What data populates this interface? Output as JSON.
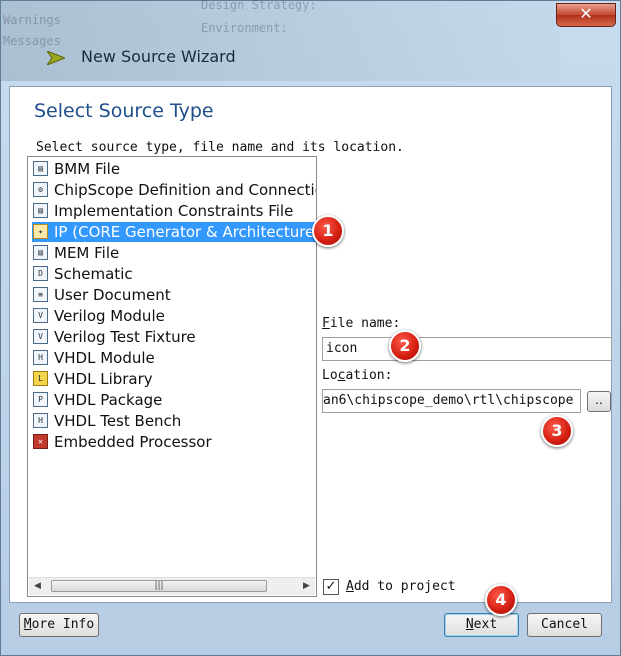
{
  "window": {
    "title": "New Source Wizard",
    "close_label": "✕",
    "background_lines": [
      "Design Strategy:",
      "Environment:",
      "Warnings",
      "Messages"
    ]
  },
  "page": {
    "heading": "Select Source Type",
    "subtitle": "Select source type, file name and its location."
  },
  "source_types": {
    "selected_index": 3,
    "items": [
      {
        "label": "BMM File",
        "icon": "bmm-file-icon",
        "glyph": "▤"
      },
      {
        "label": "ChipScope Definition and Connectio",
        "icon": "chipscope-icon",
        "glyph": "⚙"
      },
      {
        "label": "Implementation Constraints File",
        "icon": "constraints-file-icon",
        "glyph": "▤"
      },
      {
        "label": "IP (CORE Generator & Architecture",
        "icon": "ip-core-icon",
        "glyph": "✦"
      },
      {
        "label": "MEM File",
        "icon": "mem-file-icon",
        "glyph": "▤"
      },
      {
        "label": "Schematic",
        "icon": "schematic-icon",
        "glyph": "D"
      },
      {
        "label": "User Document",
        "icon": "user-document-icon",
        "glyph": "≡"
      },
      {
        "label": "Verilog Module",
        "icon": "verilog-module-icon",
        "glyph": "V"
      },
      {
        "label": "Verilog Test Fixture",
        "icon": "verilog-test-fixture-icon",
        "glyph": "V"
      },
      {
        "label": "VHDL Module",
        "icon": "vhdl-module-icon",
        "glyph": "H"
      },
      {
        "label": "VHDL Library",
        "icon": "vhdl-library-icon",
        "glyph": "L"
      },
      {
        "label": "VHDL Package",
        "icon": "vhdl-package-icon",
        "glyph": "P"
      },
      {
        "label": "VHDL Test Bench",
        "icon": "vhdl-test-bench-icon",
        "glyph": "H"
      },
      {
        "label": "Embedded Processor",
        "icon": "embedded-processor-icon",
        "glyph": "✕"
      }
    ],
    "scroll_left": "◀",
    "scroll_right": "▶",
    "scroll_thumb": "|||"
  },
  "file_name": {
    "label_mnemonic": "F",
    "label_rest": "ile name:",
    "value": "icon"
  },
  "location": {
    "label_start": "Lo",
    "label_mnemonic": "c",
    "label_rest": "ation:",
    "value": "an6\\chipscope_demo\\rtl\\chipscope",
    "browse_label": ".."
  },
  "add_to_project": {
    "checked": true,
    "check_glyph": "✓",
    "label_mnemonic": "A",
    "label_rest": "dd to project"
  },
  "buttons": {
    "more_info_mnemonic": "M",
    "more_info_rest": "ore Info",
    "next_mnemonic": "N",
    "next_rest": "ext",
    "cancel": "Cancel"
  },
  "markers": [
    "1",
    "2",
    "3",
    "4"
  ]
}
